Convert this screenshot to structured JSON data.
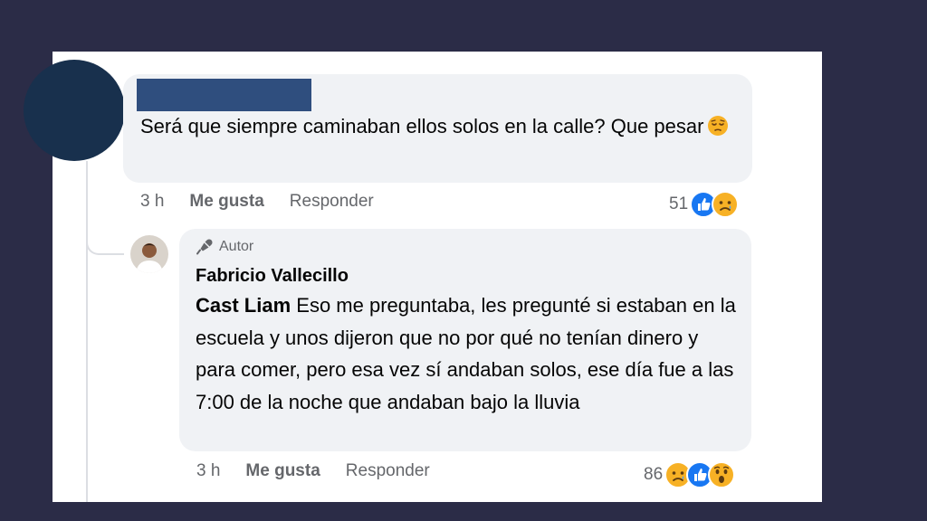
{
  "comment": {
    "text": "Será que siempre caminaban ellos solos en la calle? Que pesar",
    "emoji": "pensive-face",
    "time": "3 h",
    "like_label": "Me gusta",
    "reply_label": "Responder",
    "reaction_count": "51",
    "reactions": [
      "like",
      "sad"
    ]
  },
  "reply": {
    "badge": "Autor",
    "author": "Fabricio Vallecillo",
    "mention": "Cast Liam",
    "text": "Eso me preguntaba, les pregunté si estaban en la escuela y unos dijeron que no por qué no tenían dinero y para comer, pero esa vez sí andaban solos, ese día fue a las 7:00 de la noche que andaban bajo la lluvia",
    "time": "3 h",
    "like_label": "Me gusta",
    "reply_label": "Responder",
    "reaction_count": "86",
    "reactions": [
      "sad",
      "like",
      "wow"
    ]
  },
  "colors": {
    "background": "#2b2c47",
    "card": "#ffffff",
    "bubble": "#f0f2f5",
    "avatar": "#18304d",
    "redaction": "#2f4e7e",
    "meta_text": "#65676b",
    "like_blue": "#1877f2",
    "emoji_yellow": "#f7b125"
  }
}
